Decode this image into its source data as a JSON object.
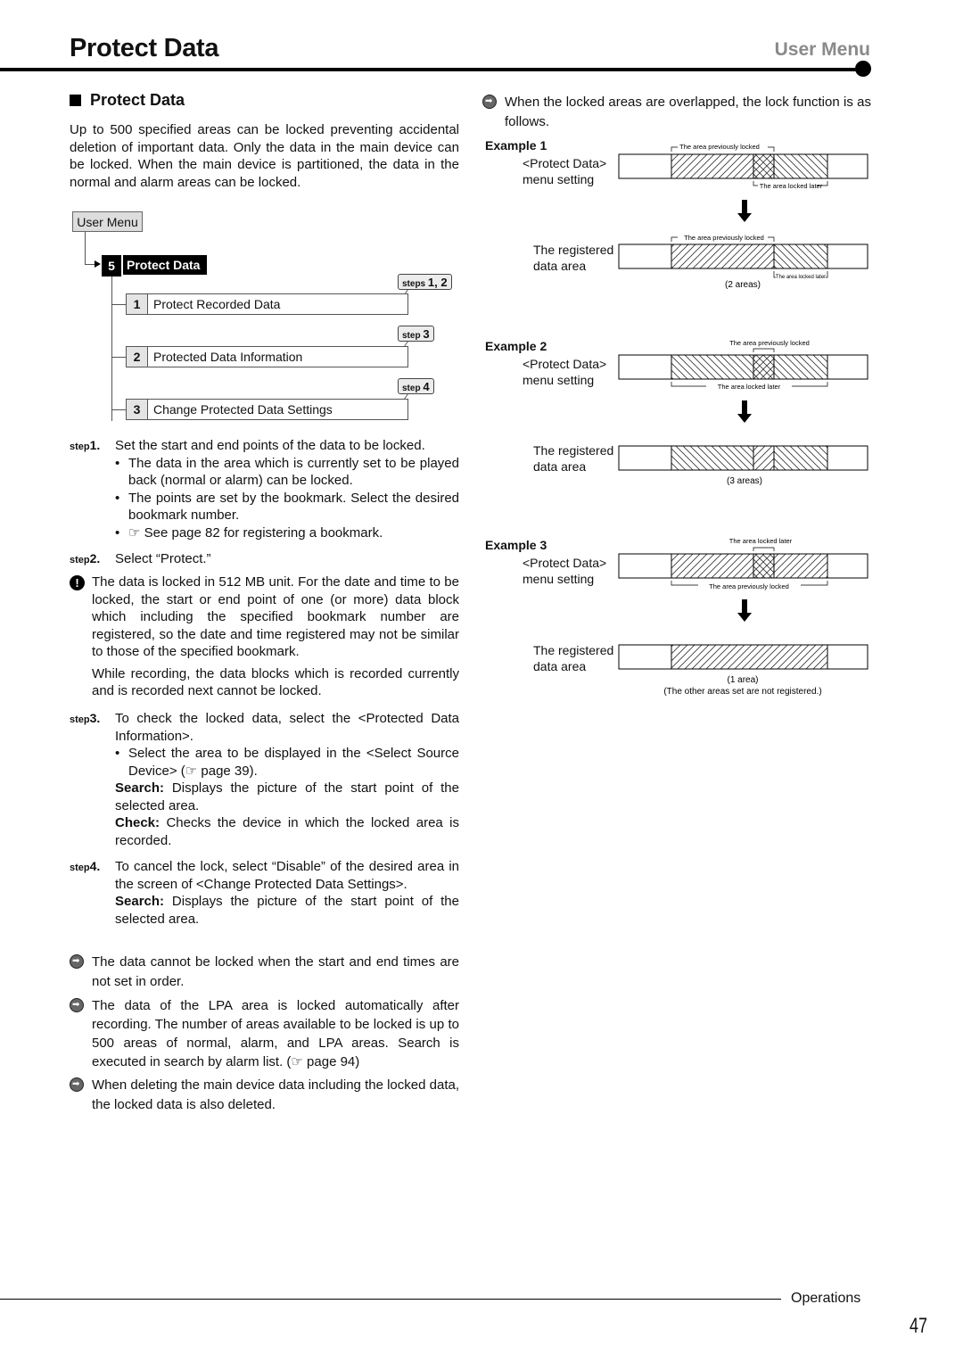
{
  "header": {
    "title": "Protect Data",
    "section": "User Menu"
  },
  "section_heading": "Protect Data",
  "intro": "Up to 500 specified areas can be locked preventing accidental deletion of important data. Only the data in the main device can be locked. When the main device is partitioned, the data in the normal and alarm areas can be locked.",
  "menu_tree": {
    "root": "User Menu",
    "parent": {
      "number": "5",
      "label": "Protect Data"
    },
    "items": [
      {
        "number": "1",
        "label": "Protect Recorded Data",
        "callout_prefix": "steps",
        "callout_steps": "1, 2"
      },
      {
        "number": "2",
        "label": "Protected Data Information",
        "callout_prefix": "step",
        "callout_steps": "3"
      },
      {
        "number": "3",
        "label": "Change Protected Data Settings",
        "callout_prefix": "step",
        "callout_steps": "4"
      }
    ]
  },
  "steps": [
    {
      "prefix": "step",
      "number": "1.",
      "text": "Set the start and end points of the data to be locked.",
      "bullets": [
        "The data in the area which is currently set to be played back (normal or alarm) can be locked.",
        "The points are set by the bookmark. Select the desired bookmark number.",
        "☞ See page 82 for registering a bookmark."
      ]
    },
    {
      "prefix": "step",
      "number": "2.",
      "text": "Select “Protect.”"
    },
    {
      "prefix": "step",
      "number": "3.",
      "text": "To check the locked data, select the <Protected Data Information>.",
      "bullets": [
        "Select the area to be displayed in the <Select Source Device> (☞ page 39)."
      ],
      "defs": [
        {
          "term": "Search:",
          "desc": "Displays the picture of the start point of the selected area."
        },
        {
          "term": "Check:",
          "desc": "Checks the device in which the locked area is recorded."
        }
      ]
    },
    {
      "prefix": "step",
      "number": "4.",
      "text": "To cancel the lock, select “Disable” of the desired area in the screen of <Change Protected Data Settings>.",
      "defs": [
        {
          "term": "Search:",
          "desc": "Displays the picture of the start point of the selected area."
        }
      ]
    }
  ],
  "warning": {
    "icon": "exclamation-icon",
    "text": "The data is locked in 512 MB unit. For the date and time to be locked, the start or end point of one (or more) data block which including the specified bookmark number are registered, so the date and time registered may not be similar to those of the specified bookmark.",
    "text2": "While recording, the data blocks which is recorded currently and is recorded next cannot be locked."
  },
  "notes": [
    {
      "icon": "arrow-right-circle-icon",
      "text": "The data cannot be locked when the start and end times are not set in order."
    },
    {
      "icon": "arrow-right-circle-icon",
      "text": "The data of the LPA area is locked automatically after recording. The number of areas available to be locked is up to 500 areas of normal, alarm, and LPA areas. Search is executed in search by alarm list. (☞ page 94)"
    },
    {
      "icon": "arrow-right-circle-icon",
      "text": "When deleting the main device data including the locked data, the locked data is also deleted."
    }
  ],
  "overlap_note": "When the locked areas are overlapped, the lock function is as follows.",
  "examples": [
    {
      "label": "Example 1",
      "setting_label": "<Protect Data> menu setting",
      "setting_top_caption": "The area previously locked",
      "setting_bottom_caption": "The area locked later",
      "registered_label": "The registered data area",
      "registered_top_caption": "The area previously locked",
      "registered_bottom_caption": "The area locked later",
      "result": "(2 areas)",
      "result_note": ""
    },
    {
      "label": "Example 2",
      "setting_label": "<Protect Data> menu setting",
      "setting_top_caption": "The area previously locked",
      "setting_bottom_caption": "The area locked later",
      "registered_label": "The registered data area",
      "result": "(3 areas)",
      "result_note": ""
    },
    {
      "label": "Example 3",
      "setting_label": "<Protect Data> menu setting",
      "setting_top_caption": "The area locked later",
      "setting_bottom_caption": "The area previously locked",
      "registered_label": "The registered data area",
      "result": "(1 area)",
      "result_note": "(The other areas set are not registered.)"
    }
  ],
  "footer": {
    "section": "Operations",
    "page": "47"
  }
}
